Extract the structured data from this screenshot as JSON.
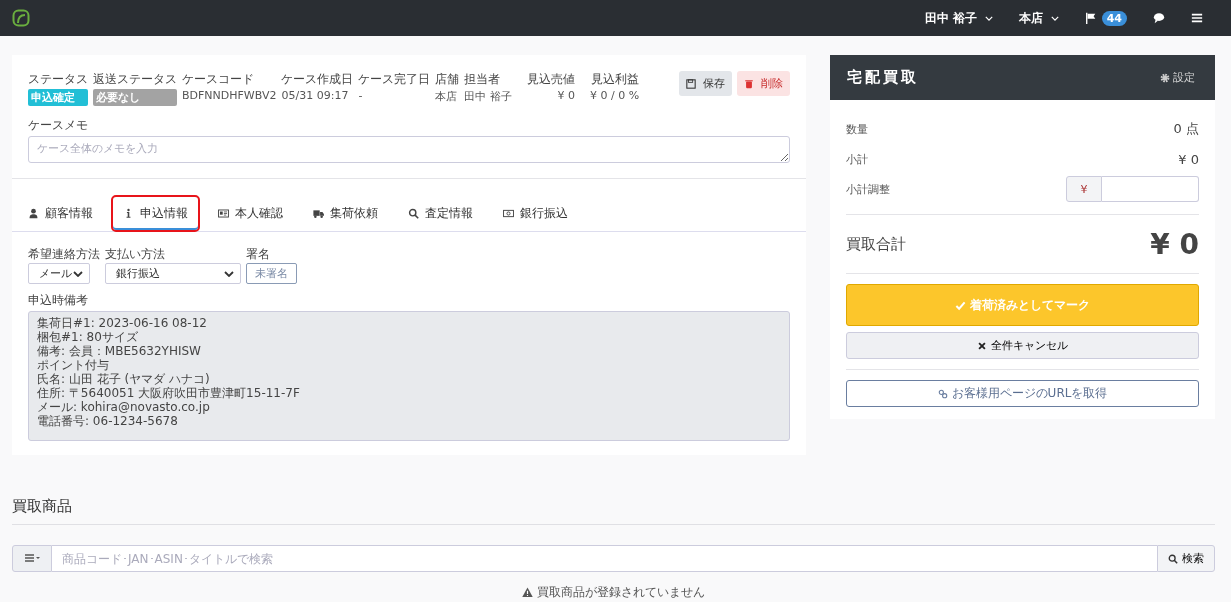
{
  "nav": {
    "user": "田中 裕子",
    "store": "本店",
    "flag_count": "44"
  },
  "case": {
    "fields": [
      {
        "label": "ステータス",
        "value": "申込確定",
        "kind": "badge",
        "color": "#22bfd6"
      },
      {
        "label": "返送ステータス",
        "value": "必要なし",
        "kind": "badge",
        "color": "#a3a3a3"
      },
      {
        "label": "ケースコード",
        "value": "BDFNNDHFWBV2",
        "kind": "text"
      },
      {
        "label": "ケース作成日",
        "value": "05/31 09:17",
        "kind": "text"
      },
      {
        "label": "ケース完了日",
        "value": "-",
        "kind": "text"
      },
      {
        "label": "店舗",
        "value": "本店",
        "kind": "text"
      },
      {
        "label": "担当者",
        "value": "田中 裕子",
        "kind": "text"
      },
      {
        "label": "見込売値",
        "value": "¥ 0",
        "kind": "number"
      },
      {
        "label": "見込利益",
        "value": "¥ 0 / 0 %",
        "kind": "number"
      }
    ],
    "buttons": [
      {
        "label": "保存",
        "kind": "save"
      },
      {
        "label": "削除",
        "kind": "delete"
      }
    ],
    "memo": {
      "label": "ケースメモ",
      "placeholder": "ケース全体のメモを入力"
    }
  },
  "tabs": [
    {
      "label": "顧客情報",
      "kind": "user",
      "selected": false
    },
    {
      "label": "申込情報",
      "kind": "info",
      "selected": true
    },
    {
      "label": "本人確認",
      "kind": "id",
      "selected": false
    },
    {
      "label": "集荷依頼",
      "kind": "truck",
      "selected": false
    },
    {
      "label": "査定情報",
      "kind": "search",
      "selected": false
    },
    {
      "label": "銀行振込",
      "kind": "money",
      "selected": false
    }
  ],
  "application": {
    "contact": {
      "label": "希望連絡方法",
      "value": "メール"
    },
    "payment": {
      "label": "支払い方法",
      "value": "銀行振込"
    },
    "signature": {
      "label": "署名",
      "value": "未署名"
    },
    "remarks": {
      "label": "申込時備考",
      "lines": [
        "集荷日#1: 2023-06-16 08-12",
        "梱包#1: 80サイズ",
        "備考: 会員：MBE5632YHISW",
        "ポイント付与",
        "氏名: 山田 花子 (ヤマダ ハナコ)",
        "住所: 〒5640051 大阪府吹田市豊津町15-11-7F",
        "メール: kohira@novasto.co.jp",
        "電話番号: 06-1234-5678"
      ]
    }
  },
  "items": {
    "title": "買取商品",
    "search": {
      "placeholder": "商品コード･JAN･ASIN･タイトルで検索",
      "button": "検索"
    },
    "empty": "買取商品が登録されていません"
  },
  "panel": {
    "title": "宅配買取",
    "settings": "設定",
    "rows": [
      {
        "label": "数量",
        "value": "0 点"
      },
      {
        "label": "小計",
        "value": "¥ 0"
      }
    ],
    "adjust": {
      "label": "小計調整",
      "prefix": "¥"
    },
    "total": {
      "label": "買取合計",
      "value": "¥ 0"
    },
    "mark_button": "着荷済みとしてマーク",
    "cancel_button": "全件キャンセル",
    "url_button": "お客様用ページのURLを取得"
  }
}
